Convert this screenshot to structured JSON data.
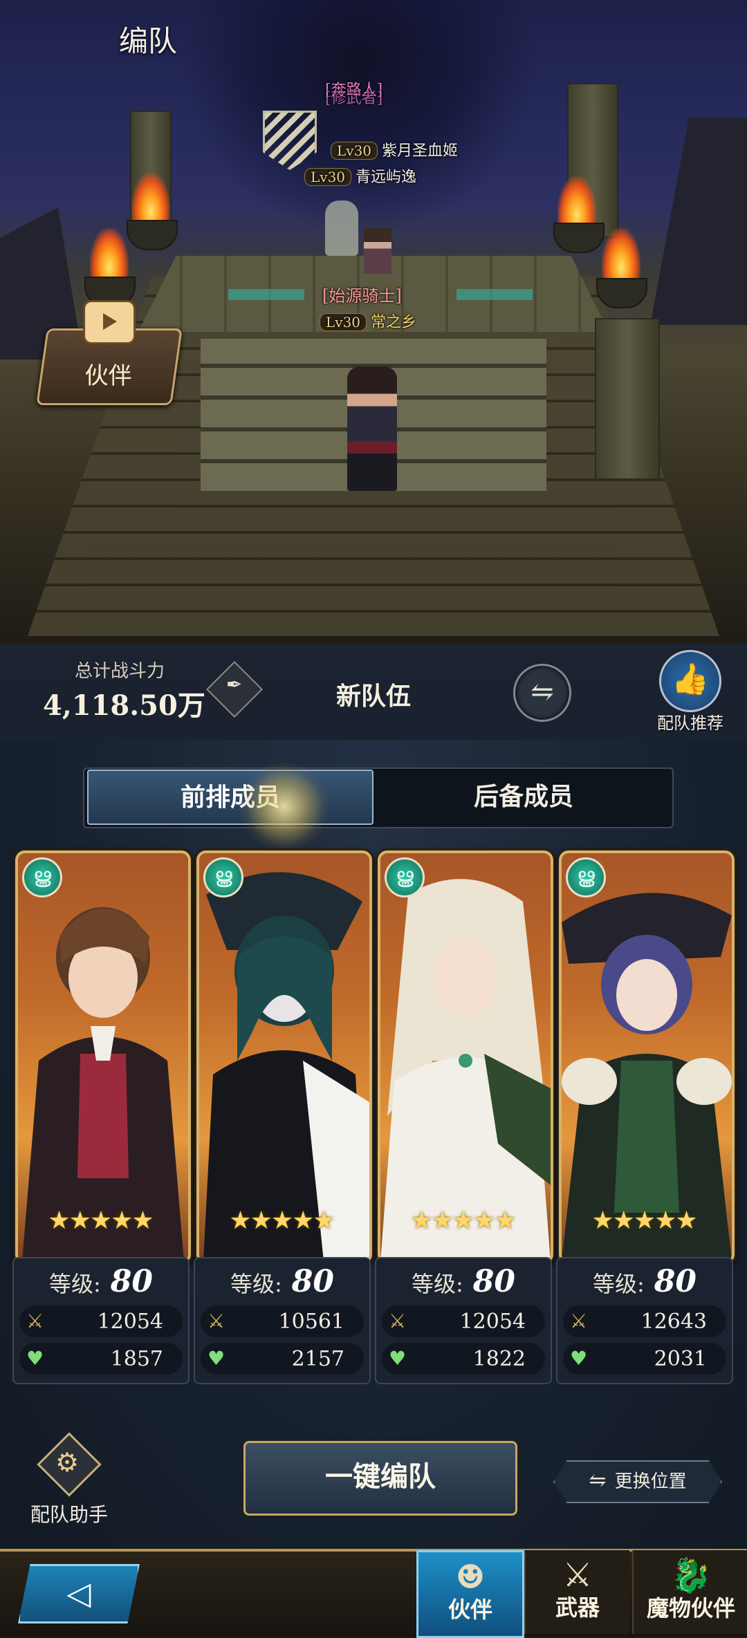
{
  "page": {
    "title": "编队"
  },
  "scene": {
    "sprites": [
      {
        "tag": "[奔路人]",
        "tag2": "[修武者]",
        "level": "Lv30",
        "name": "紫月圣血姬"
      },
      {
        "level": "Lv30",
        "name": "青远屿逸"
      },
      {
        "tag": "[始源骑士]",
        "level": "Lv30",
        "name": "常之乡"
      }
    ],
    "partner_video_label": "伙伴"
  },
  "power": {
    "label": "总计战斗力",
    "value": "4,118.50万",
    "team_name": "新队伍",
    "recommend_label": "配队推荐"
  },
  "tabs": {
    "front": "前排成员",
    "reserve": "后备成员"
  },
  "cards": [
    {
      "element": "wind-icon",
      "stars": "★★★★★",
      "level_label": "等级:",
      "level": "80",
      "attack": "12054",
      "hp": "1857"
    },
    {
      "element": "wind-icon",
      "stars": "★★★★★",
      "level_label": "等级:",
      "level": "80",
      "attack": "10561",
      "hp": "2157"
    },
    {
      "element": "wind-icon",
      "stars": "★★★★★",
      "level_label": "等级:",
      "level": "80",
      "attack": "12054",
      "hp": "1822"
    },
    {
      "element": "wind-icon",
      "stars": "★★★★★",
      "level_label": "等级:",
      "level": "80",
      "attack": "12643",
      "hp": "2031"
    }
  ],
  "controls": {
    "assistant_label": "配队助手",
    "auto_form_label": "一键编队",
    "swap_position_label": "更换位置"
  },
  "nav": {
    "partner": "伙伴",
    "weapon": "武器",
    "monster": "魔物伙伴"
  }
}
